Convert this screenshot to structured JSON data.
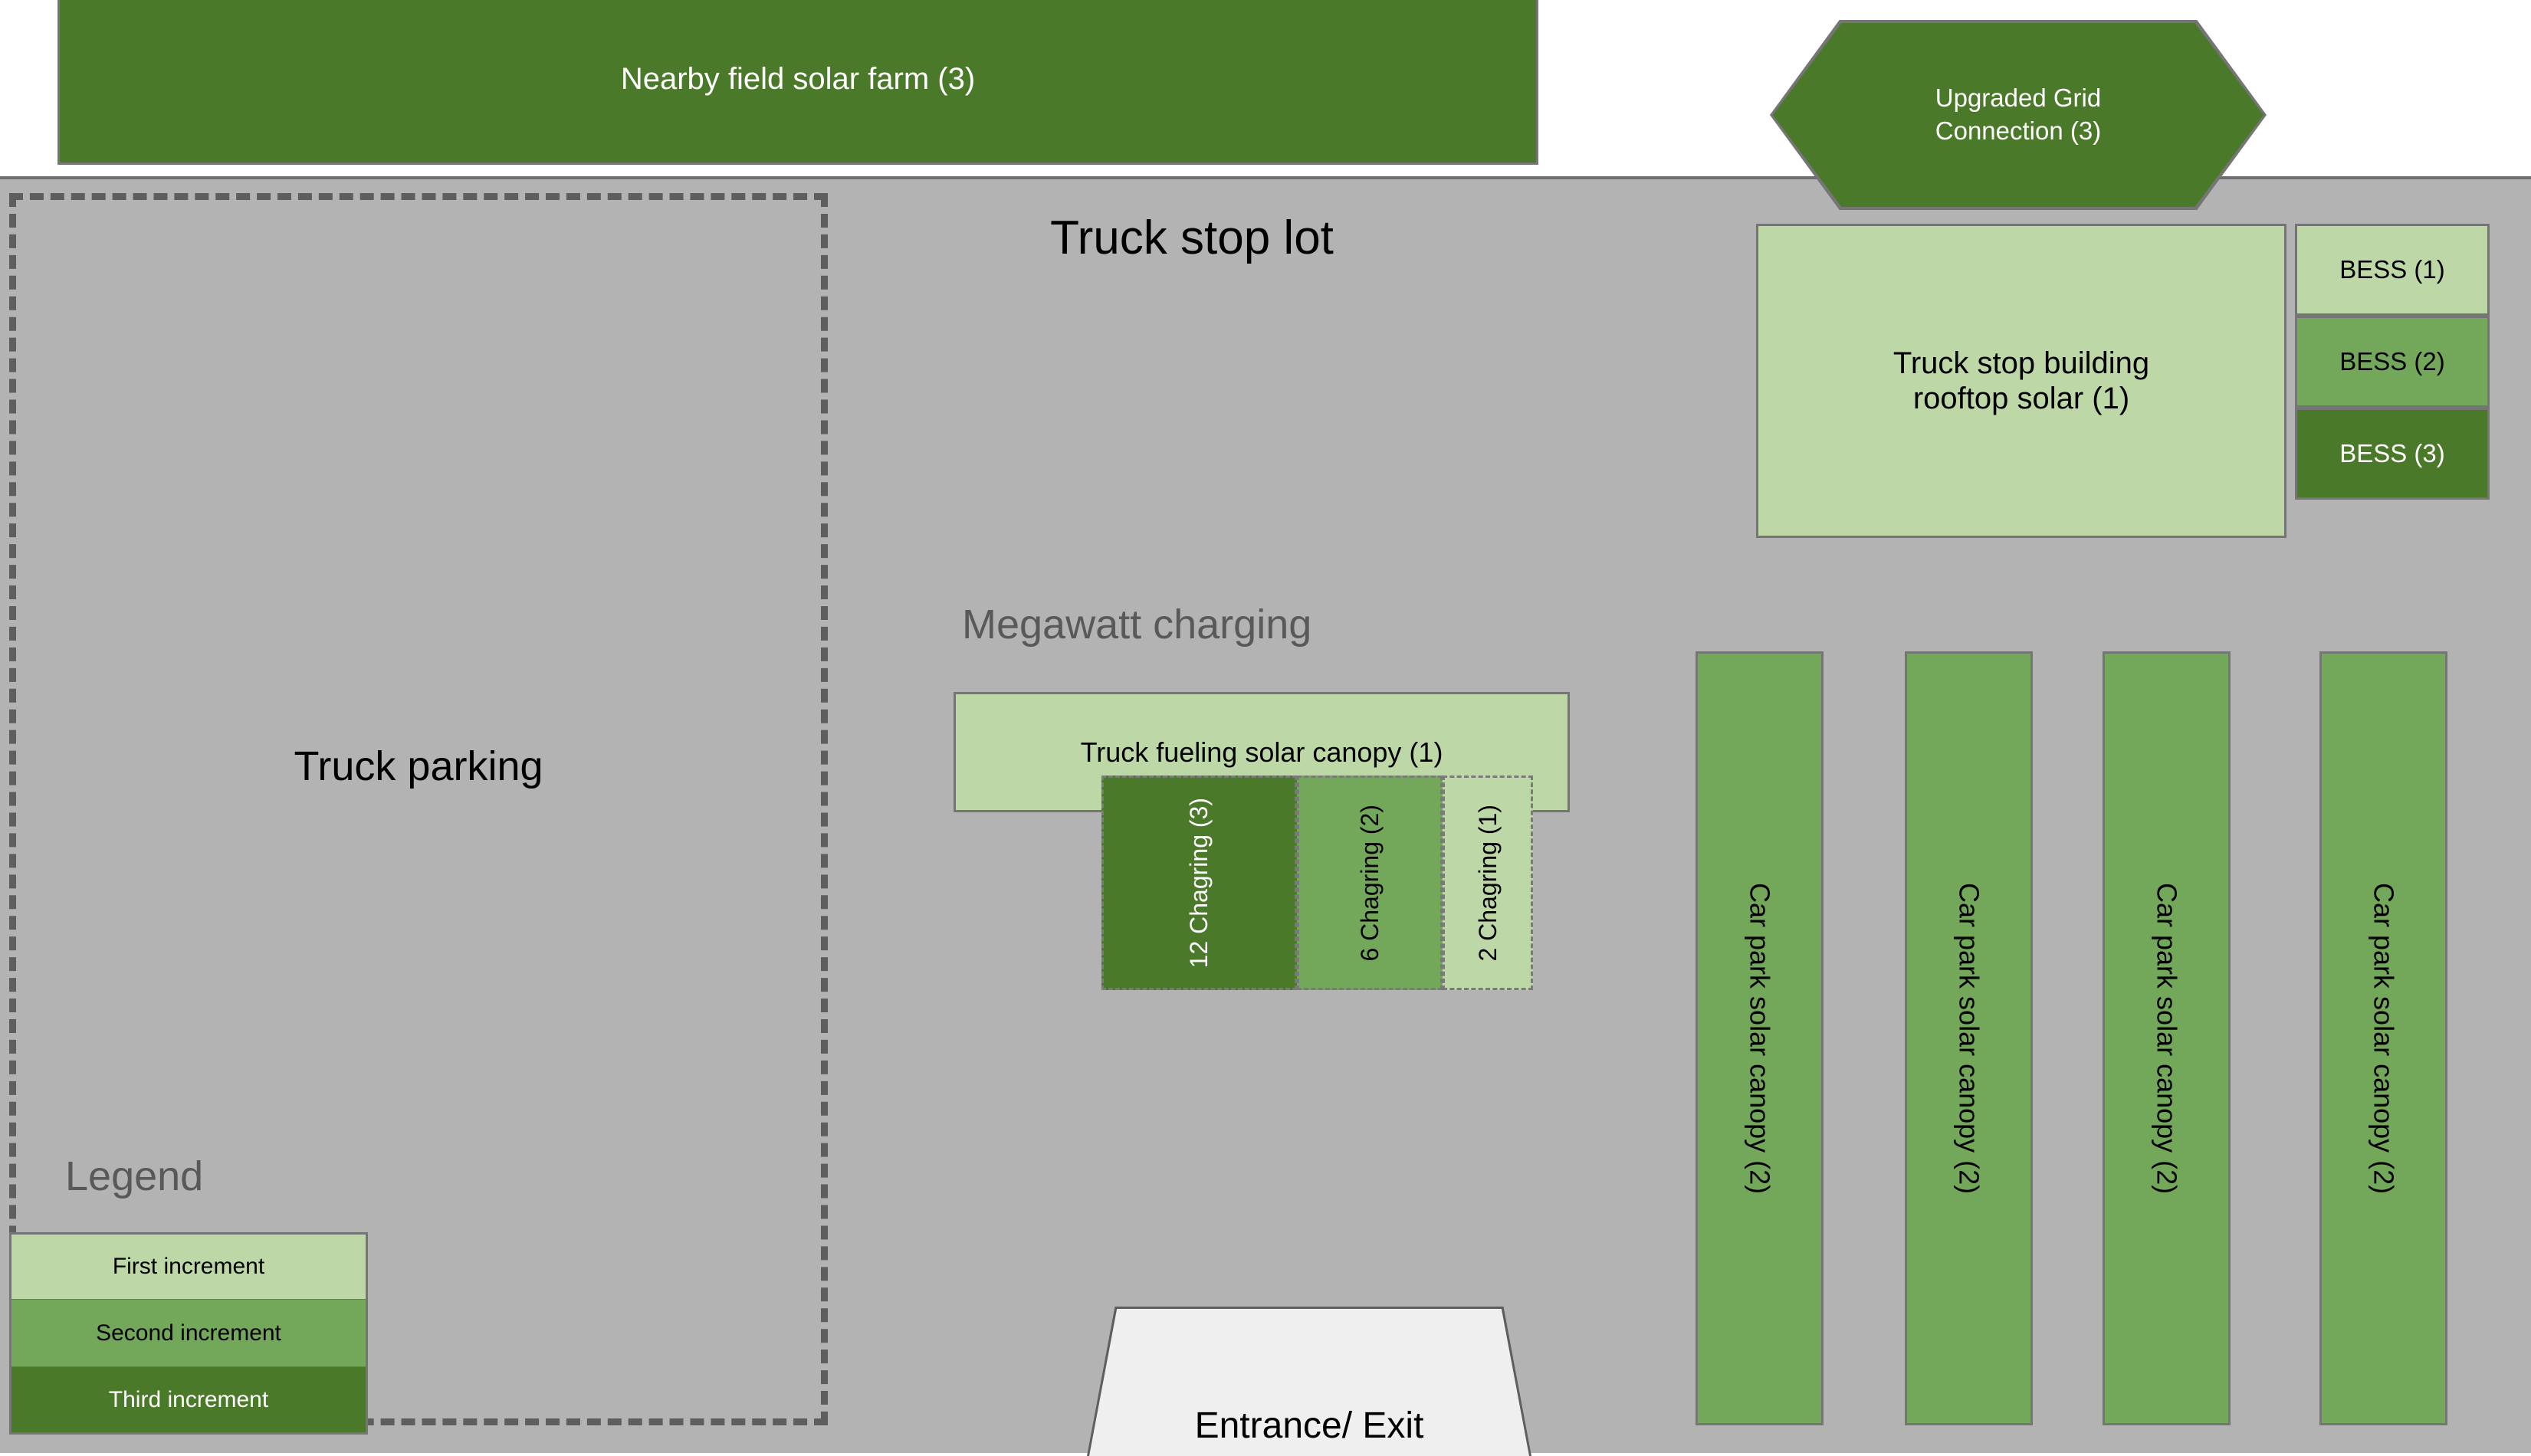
{
  "site": {
    "lot_title": "Truck stop lot",
    "truck_parking_label": "Truck parking",
    "megawatt_charging_label": "Megawatt charging",
    "entrance_label": "Entrance/ Exit"
  },
  "assets": {
    "field_solar_farm": "Nearby field solar farm (3)",
    "grid_connection": "Upgraded Grid\nConnection (3)",
    "grid_connection_line1": "Upgraded Grid",
    "grid_connection_line2": "Connection (3)",
    "rooftop_solar_line1": "Truck stop building",
    "rooftop_solar_line2": "rooftop solar (1)",
    "fuel_canopy": "Truck fueling solar canopy (1)",
    "bess": [
      {
        "label": "BESS (1)",
        "increment": 1
      },
      {
        "label": "BESS (2)",
        "increment": 2
      },
      {
        "label": "BESS (3)",
        "increment": 3
      }
    ],
    "charging": [
      {
        "label": "12 Chagring (3)",
        "increment": 3
      },
      {
        "label": "6 Chagring (2)",
        "increment": 2
      },
      {
        "label": "2 Chagring (1)",
        "increment": 1
      }
    ],
    "car_park_canopies": [
      {
        "label": "Car park solar canopy (2)",
        "increment": 2
      },
      {
        "label": "Car park solar canopy (2)",
        "increment": 2
      },
      {
        "label": "Car park solar canopy (2)",
        "increment": 2
      },
      {
        "label": "Car park solar canopy (2)",
        "increment": 2
      }
    ]
  },
  "legend": {
    "title": "Legend",
    "items": [
      {
        "label": "First increment",
        "color": "#bdd7a7"
      },
      {
        "label": "Second increment",
        "color": "#73a85b"
      },
      {
        "label": "Third increment",
        "color": "#4a7a29"
      }
    ]
  },
  "colors": {
    "first_increment": "#bdd7a7",
    "second_increment": "#73a85b",
    "third_increment": "#4a7a29",
    "lot_background": "#b3b3b3",
    "outline": "#757575",
    "muted_text": "#595959",
    "entrance_fill": "#efefef"
  }
}
